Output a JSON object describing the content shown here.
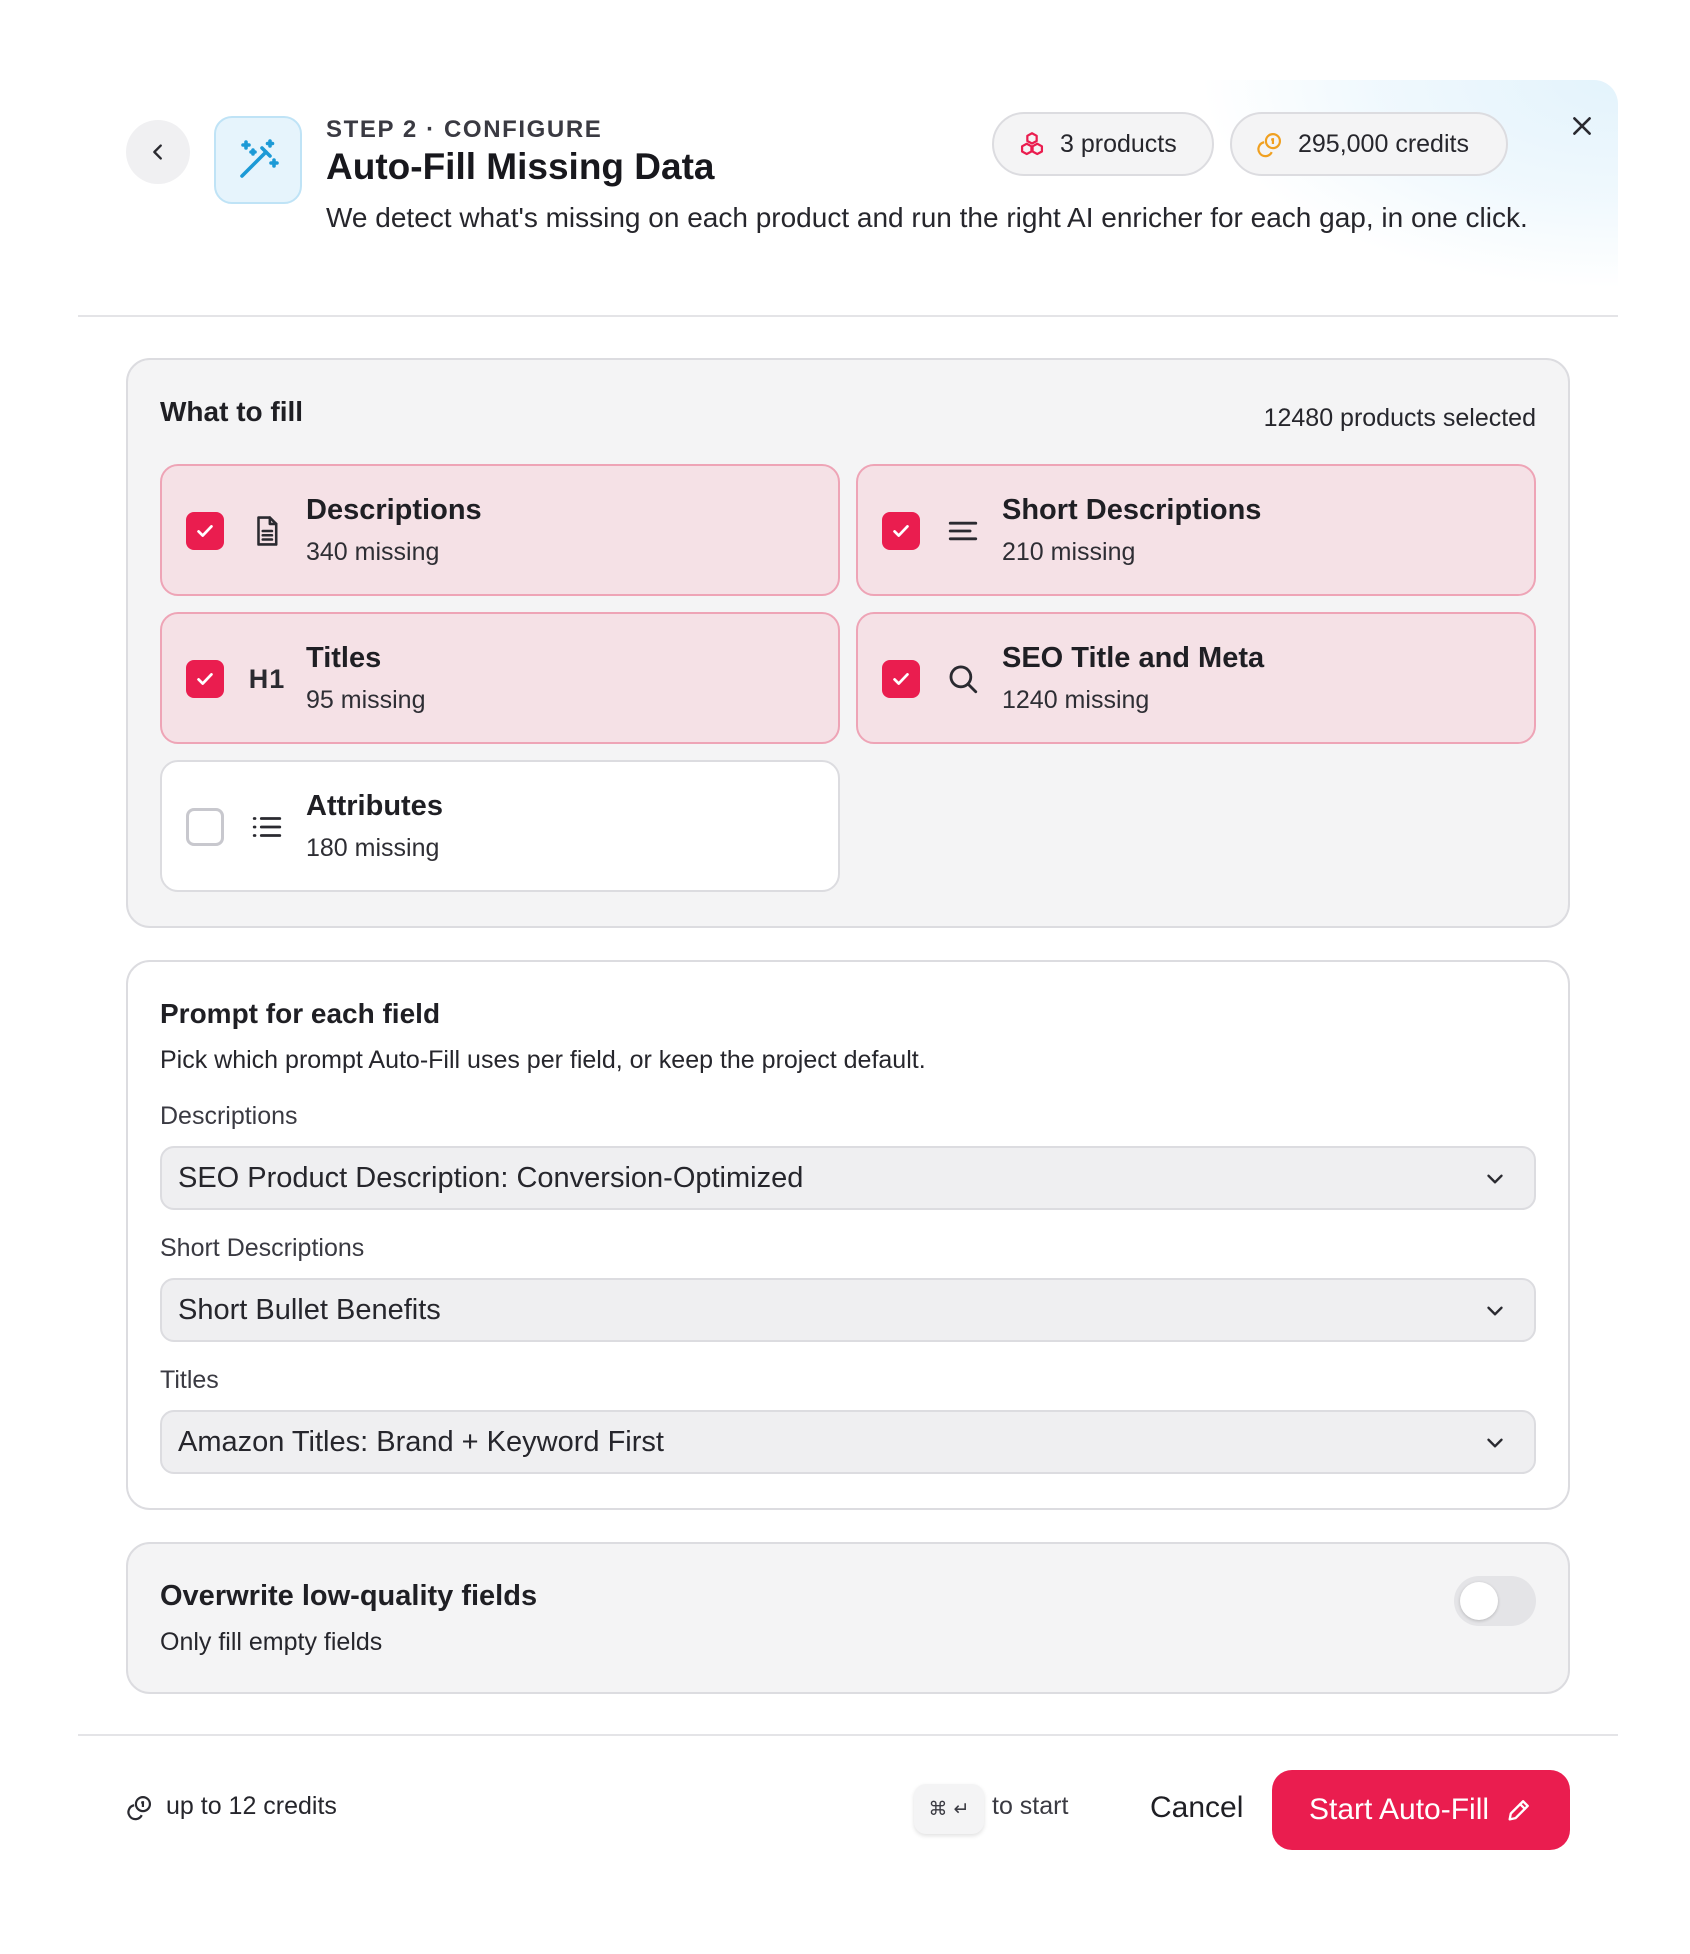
{
  "header": {
    "step_label": "STEP 2 · CONFIGURE",
    "title": "Auto-Fill Missing Data",
    "subtitle": "We detect what's missing on each product and run the right AI enricher for each gap, in one click.",
    "products_pill": "3 products",
    "credits_pill": "295,000 credits"
  },
  "fill_section": {
    "title": "What to fill",
    "selected_count": "12480 products selected",
    "fields": [
      {
        "name": "Descriptions",
        "missing": "340 missing",
        "checked": true,
        "icon": "document-icon"
      },
      {
        "name": "Short Descriptions",
        "missing": "210 missing",
        "checked": true,
        "icon": "short-text-icon"
      },
      {
        "name": "Titles",
        "missing": "95 missing",
        "checked": true,
        "icon": "heading-h1-icon",
        "glyph": "H1"
      },
      {
        "name": "SEO Title and Meta",
        "missing": "1240 missing",
        "checked": true,
        "icon": "search-icon"
      },
      {
        "name": "Attributes",
        "missing": "180 missing",
        "checked": false,
        "icon": "list-icon"
      }
    ]
  },
  "prompt_section": {
    "title": "Prompt for each field",
    "description": "Pick which prompt Auto-Fill uses per field, or keep the project default.",
    "selects": [
      {
        "label": "Descriptions",
        "value": "SEO Product Description: Conversion-Optimized"
      },
      {
        "label": "Short Descriptions",
        "value": "Short Bullet Benefits"
      },
      {
        "label": "Titles",
        "value": "Amazon Titles: Brand + Keyword First"
      }
    ]
  },
  "overwrite_section": {
    "title": "Overwrite low-quality fields",
    "subtitle": "Only fill empty fields",
    "enabled": false
  },
  "footer": {
    "cost_note": "up to 12 credits",
    "shortcut_keys": "⌘ ↵",
    "shortcut_hint": "to start",
    "cancel_label": "Cancel",
    "start_label": "Start Auto-Fill"
  },
  "colors": {
    "accent": "#ea1d4f",
    "selected_tile_bg": "#f5e1e6",
    "selected_tile_border": "#eea4b6",
    "credits_icon": "#f0a020",
    "app_icon": "#1c9ad6"
  }
}
